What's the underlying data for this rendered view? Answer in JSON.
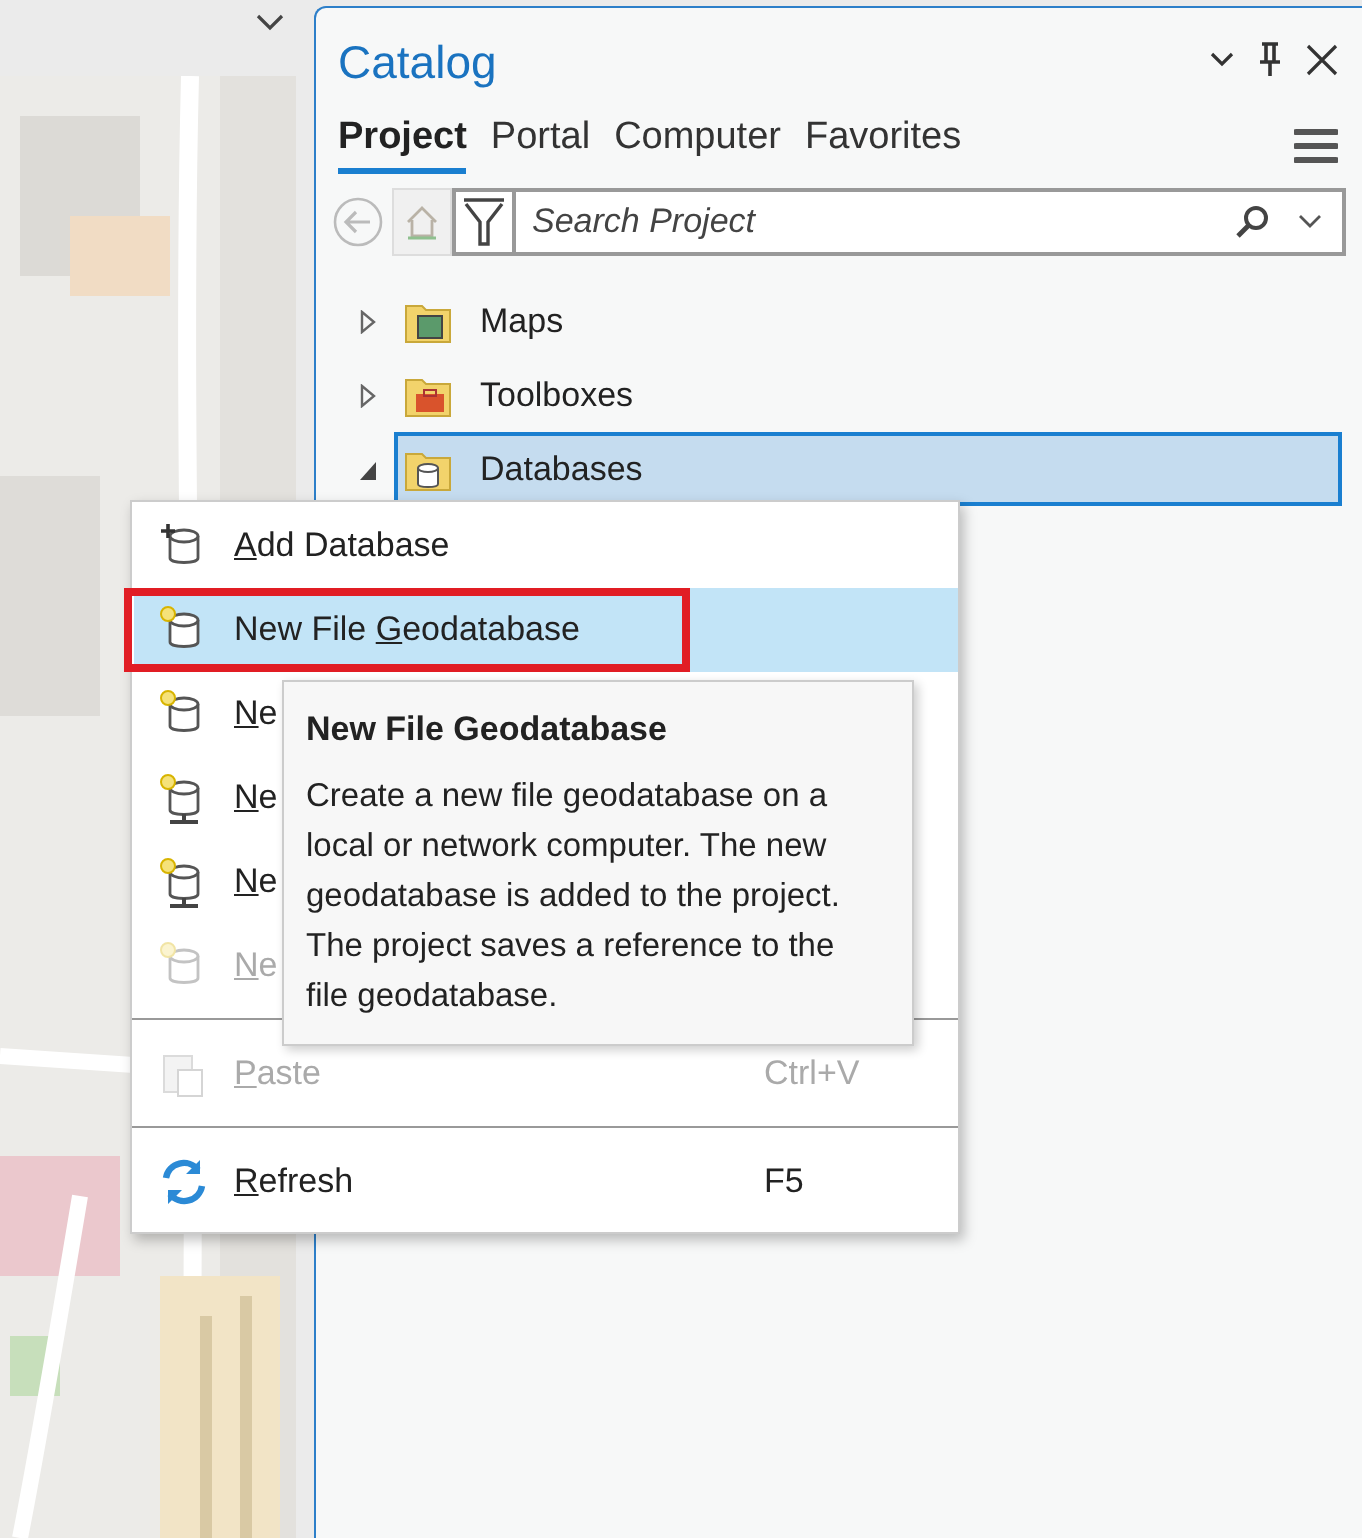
{
  "catalog": {
    "title": "Catalog",
    "tabs": [
      {
        "label": "Project",
        "selected": true
      },
      {
        "label": "Portal",
        "selected": false
      },
      {
        "label": "Computer",
        "selected": false
      },
      {
        "label": "Favorites",
        "selected": false
      }
    ],
    "search": {
      "placeholder": "Search Project"
    },
    "tree": [
      {
        "label": "Maps",
        "expanded": false,
        "selected": false
      },
      {
        "label": "Toolboxes",
        "expanded": false,
        "selected": false
      },
      {
        "label": "Databases",
        "expanded": true,
        "selected": true
      }
    ]
  },
  "context_menu": {
    "items": [
      {
        "kind": "add",
        "key": "A",
        "post": "dd Database",
        "selected": false,
        "disabled": false,
        "outlined": false
      },
      {
        "kind": "create",
        "pre": "New File ",
        "key": "G",
        "post": "eodatabase",
        "selected": true,
        "disabled": false,
        "outlined": true
      },
      {
        "kind": "create",
        "key": "N",
        "post": "e",
        "selected": false,
        "disabled": false,
        "outlined": false
      },
      {
        "kind": "server",
        "key": "N",
        "post": "e",
        "selected": false,
        "disabled": false,
        "outlined": false
      },
      {
        "kind": "server",
        "key": "N",
        "post": "e",
        "selected": false,
        "disabled": false,
        "outlined": false
      },
      {
        "kind": "create",
        "key": "N",
        "post": "e",
        "selected": false,
        "disabled": true,
        "outlined": false
      },
      {
        "kind": "separator"
      },
      {
        "kind": "paste",
        "key": "P",
        "post": "aste",
        "shortcut": "Ctrl+V",
        "selected": false,
        "disabled": true,
        "outlined": false
      },
      {
        "kind": "separator"
      },
      {
        "kind": "refresh",
        "key": "R",
        "post": "efresh",
        "shortcut": "F5",
        "selected": false,
        "disabled": false,
        "outlined": false
      }
    ]
  },
  "tooltip": {
    "title": "New File Geodatabase",
    "body": "Create a new file geodatabase on a local or network computer. The new geodatabase is added to the project. The project saves a reference to the file geodatabase."
  }
}
